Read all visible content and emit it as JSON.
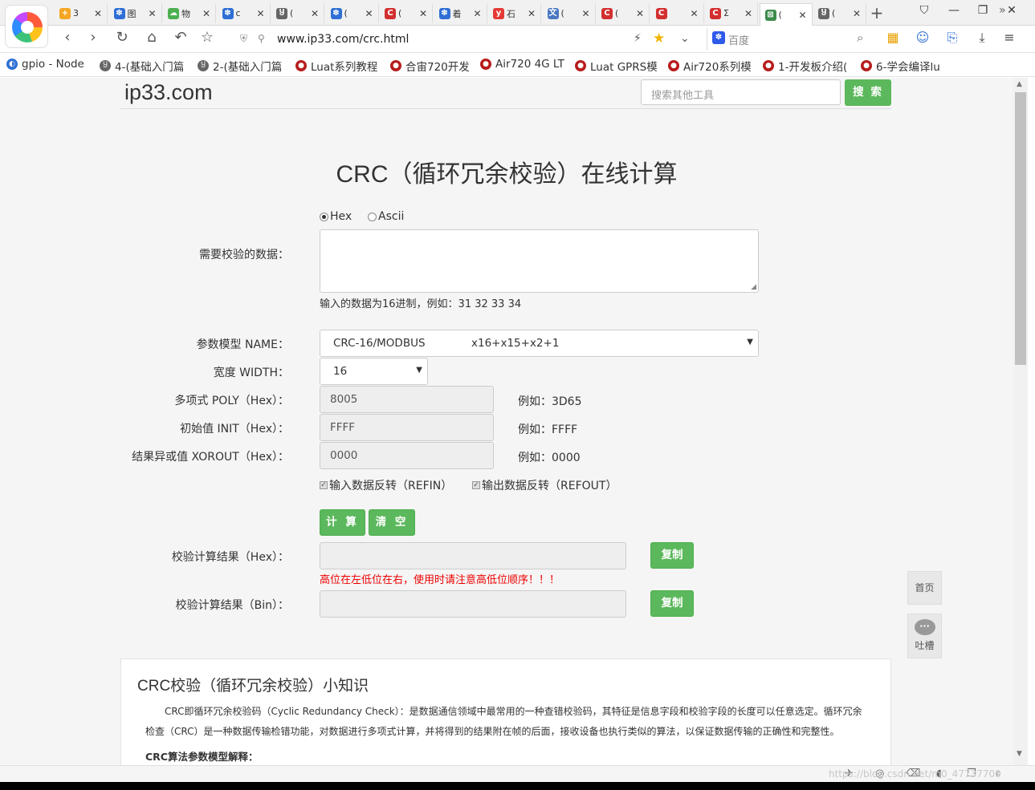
{
  "browser": {
    "tabs": [
      {
        "label": "3",
        "color": "#f5a623",
        "glyph": "+"
      },
      {
        "label": "图",
        "color": "#2f6fd6",
        "glyph": "✽"
      },
      {
        "label": "物",
        "color": "#4caf50",
        "glyph": "☁"
      },
      {
        "label": "c",
        "color": "#2f6fd6",
        "glyph": "✽"
      },
      {
        "label": "(",
        "color": "#666666",
        "glyph": "Ⴘ"
      },
      {
        "label": "(",
        "color": "#2f6fd6",
        "glyph": "✽"
      },
      {
        "label": "(",
        "color": "#d32f2f",
        "glyph": "C"
      },
      {
        "label": "着",
        "color": "#2f6fd6",
        "glyph": "✽"
      },
      {
        "label": "石",
        "color": "#e53935",
        "glyph": "y"
      },
      {
        "label": "(",
        "color": "#4a78c2",
        "glyph": "文"
      },
      {
        "label": "(",
        "color": "#d32f2f",
        "glyph": "C"
      },
      {
        "label": "",
        "color": "#d32f2f",
        "glyph": "C"
      },
      {
        "label": "Σ",
        "color": "#d32f2f",
        "glyph": "C"
      },
      {
        "label": "(",
        "color": "#3c8b4c",
        "glyph": "⊠"
      },
      {
        "label": "(",
        "color": "#666666",
        "glyph": "Ⴘ"
      }
    ],
    "active_tab_index": 13,
    "url": "www.ip33.com/crc.html",
    "search_engine": "百度"
  },
  "bookmarks": [
    {
      "label": "gpio - Node",
      "color": "#2f6fd6",
      "glyph": "◐"
    },
    {
      "label": "4-(基础入门篇",
      "color": "#666666",
      "glyph": "Ⴘ"
    },
    {
      "label": "2-(基础入门篇",
      "color": "#666666",
      "glyph": "Ⴘ"
    },
    {
      "label": "Luat系列教程",
      "color": "#b71c1c",
      "glyph": "●"
    },
    {
      "label": "合宙720开发",
      "color": "#b71c1c",
      "glyph": "●"
    },
    {
      "label": "Air720 4G LT",
      "color": "#b71c1c",
      "glyph": "●"
    },
    {
      "label": "Luat GPRS模",
      "color": "#b71c1c",
      "glyph": "●"
    },
    {
      "label": "Air720系列模",
      "color": "#b71c1c",
      "glyph": "●"
    },
    {
      "label": "1-开发板介绍(",
      "color": "#b71c1c",
      "glyph": "●"
    },
    {
      "label": "6-学会编译lu",
      "color": "#b71c1c",
      "glyph": "●"
    }
  ],
  "site": {
    "logo": "ip33.com",
    "search_placeholder": "搜索其他工具",
    "search_button": "搜 索"
  },
  "form": {
    "title": "CRC（循环冗余校验）在线计算",
    "radio_hex": "Hex",
    "radio_ascii": "Ascii",
    "data_label": "需要校验的数据：",
    "data_hint": "输入的数据为16进制，例如：31 32 33 34",
    "model_label": "参数模型 NAME：",
    "model_name": "CRC-16/MODBUS",
    "model_poly": "x16+x15+x2+1",
    "width_label": "宽度 WIDTH：",
    "width_value": "16",
    "poly_label": "多项式 POLY（Hex）：",
    "poly_value": "8005",
    "poly_example": "例如：3D65",
    "init_label": "初始值 INIT（Hex）：",
    "init_value": "FFFF",
    "init_example": "例如：FFFF",
    "xorout_label": "结果异或值 XOROUT（Hex）：",
    "xorout_value": "0000",
    "xorout_example": "例如：0000",
    "refin_label": "输入数据反转（REFIN）",
    "refout_label": "输出数据反转（REFOUT）",
    "calc_button": "计 算",
    "clear_button": "清 空",
    "result_hex_label": "校验计算结果（Hex）：",
    "result_bin_label": "校验计算结果（Bin）：",
    "copy_button": "复制",
    "warning": "高位在左低位在右，使用时请注意高低位顺序！！！"
  },
  "float": {
    "home": "首页",
    "feedback": "吐槽",
    "feedback_icon": "···"
  },
  "info": {
    "title": "CRC校验（循环冗余校验）小知识",
    "paragraph": "CRC即循环冗余校验码（Cyclic Redundancy Check）：是数据通信领域中最常用的一种查错校验码，其特征是信息字段和校验字段的长度可以任意选定。循环冗余检查（CRC）是一种数据传输检错功能，对数据进行多项式计算，并将得到的结果附在帧的后面，接收设备也执行类似的算法，以保证数据传输的正确性和完整性。",
    "subheading": "CRC算法参数模型解释："
  },
  "status": {
    "watermark": "https://blog.csdn.net/m0_47737700"
  }
}
